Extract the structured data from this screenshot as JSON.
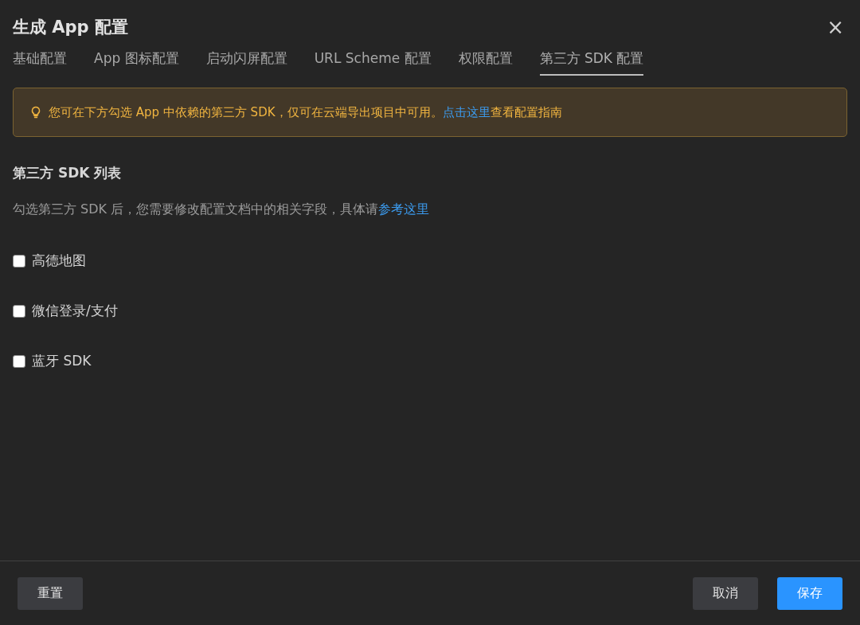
{
  "window": {
    "title": "生成 App 配置",
    "close": "×"
  },
  "tabs": [
    {
      "label": "基础配置",
      "selected": false
    },
    {
      "label": "App 图标配置",
      "selected": false
    },
    {
      "label": "启动闪屏配置",
      "selected": false
    },
    {
      "label": "URL Scheme 配置",
      "selected": false
    },
    {
      "label": "权限配置",
      "selected": false
    },
    {
      "label": "第三方 SDK 配置",
      "selected": true
    }
  ],
  "notice": {
    "text_before": "您可在下方勾选 App 中依赖的第三方 SDK，仅可在云端导出项目中可用。",
    "link": "点击这里",
    "text_after": "查看配置指南"
  },
  "section": {
    "title": "第三方 SDK 列表",
    "text_before": "勾选第三方 SDK 后，您需要修改配置文档中的相关字段，具体请",
    "link": "参考这里"
  },
  "sdks": [
    {
      "label": "高德地图",
      "checked": false
    },
    {
      "label": "微信登录/支付",
      "checked": false
    },
    {
      "label": "蓝牙 SDK",
      "checked": false
    }
  ],
  "footer": {
    "left_buttons": [
      {
        "label": "重置",
        "kind": "default"
      }
    ],
    "right_buttons": [
      {
        "label": "取消",
        "kind": "default"
      },
      {
        "label": "保存",
        "kind": "primary"
      }
    ]
  }
}
